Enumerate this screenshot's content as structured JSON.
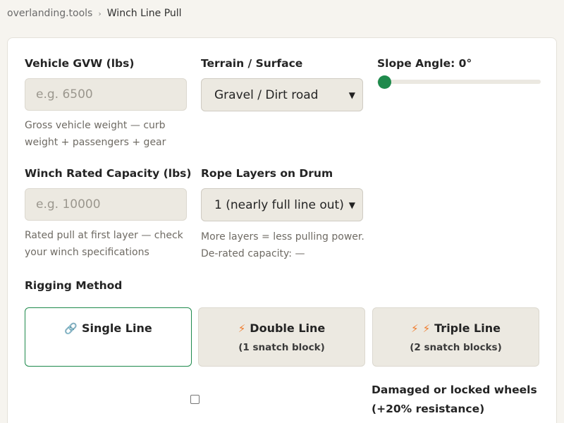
{
  "breadcrumb": {
    "site": "overlanding.tools",
    "separator": "›",
    "current": "Winch Line Pull"
  },
  "form": {
    "gvw": {
      "label": "Vehicle GVW (lbs)",
      "placeholder": "e.g. 6500",
      "hint_line1": "Gross vehicle weight — curb",
      "hint_line2": "weight + passengers + gear"
    },
    "terrain": {
      "label": "Terrain / Surface",
      "selected": "Gravel / Dirt road"
    },
    "slope": {
      "label": "Slope Angle: 0°",
      "value": 0,
      "accent": "#1e8a4c"
    },
    "winch": {
      "label": "Winch Rated Capacity (lbs)",
      "placeholder": "e.g. 10000",
      "hint_line1": "Rated pull at first layer — check",
      "hint_line2": "your winch specifications"
    },
    "layers": {
      "label": "Rope Layers on Drum",
      "selected": "1 (nearly full line out)",
      "hint_line1": "More layers = less pulling power.",
      "hint_line2": "De-rated capacity: —"
    },
    "rigging": {
      "label": "Rigging Method",
      "options": [
        {
          "title": "Single Line",
          "subtitle": "",
          "icon": "link-icon",
          "selected": true
        },
        {
          "title": "Double Line",
          "subtitle": "(1 snatch block)",
          "icon": "lightning-icon",
          "selected": false
        },
        {
          "title": "Triple Line",
          "subtitle": "(2 snatch blocks)",
          "icon": "lightning-icon",
          "selected": false
        }
      ]
    },
    "damaged": {
      "label_line1": "Damaged or locked wheels",
      "label_line2": "(+20% resistance)",
      "checked": false
    }
  },
  "colors": {
    "accent": "#1e8a4c",
    "bolt": "#f07a2a"
  }
}
